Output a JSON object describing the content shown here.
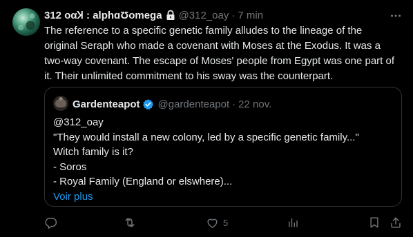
{
  "author": {
    "display_name": "312 οαꞰ : alphɑƱomega",
    "handle": "@312_oay",
    "separator": "·",
    "time": "7 min",
    "locked": true
  },
  "tweet_text": "The reference to a specific genetic family alludes to the lineage of the original Seraph who made a covenant with Moses at the Exodus. It was a two-way covenant. The escape of Moses' people from Egypt was one part of it. Their unlimited commitment to his sway was the counterpart.",
  "quoted": {
    "display_name": "Gardenteapot",
    "verified": true,
    "handle": "@gardenteapot",
    "separator": "·",
    "date": "22 nov.",
    "lines": [
      "@312_oay",
      "\"They would install a new colony, led by a specific genetic family...\"",
      "Witch family is it?",
      "- Soros",
      "- Royal Family (England or elswhere)..."
    ],
    "show_more": "Voir plus"
  },
  "actions": {
    "reply_count": "",
    "retweet_count": "",
    "like_count": "5",
    "views_count": ""
  },
  "icons": [
    "more-icon",
    "lock-icon",
    "verified-icon",
    "reply-icon",
    "retweet-icon",
    "like-icon",
    "views-icon",
    "bookmark-icon",
    "share-icon"
  ],
  "colors": {
    "background": "#000000",
    "text": "#e7e9ea",
    "secondary": "#71767b",
    "border": "#2f3336",
    "link": "#1d9bf0",
    "verified": "#1d9bf0"
  }
}
